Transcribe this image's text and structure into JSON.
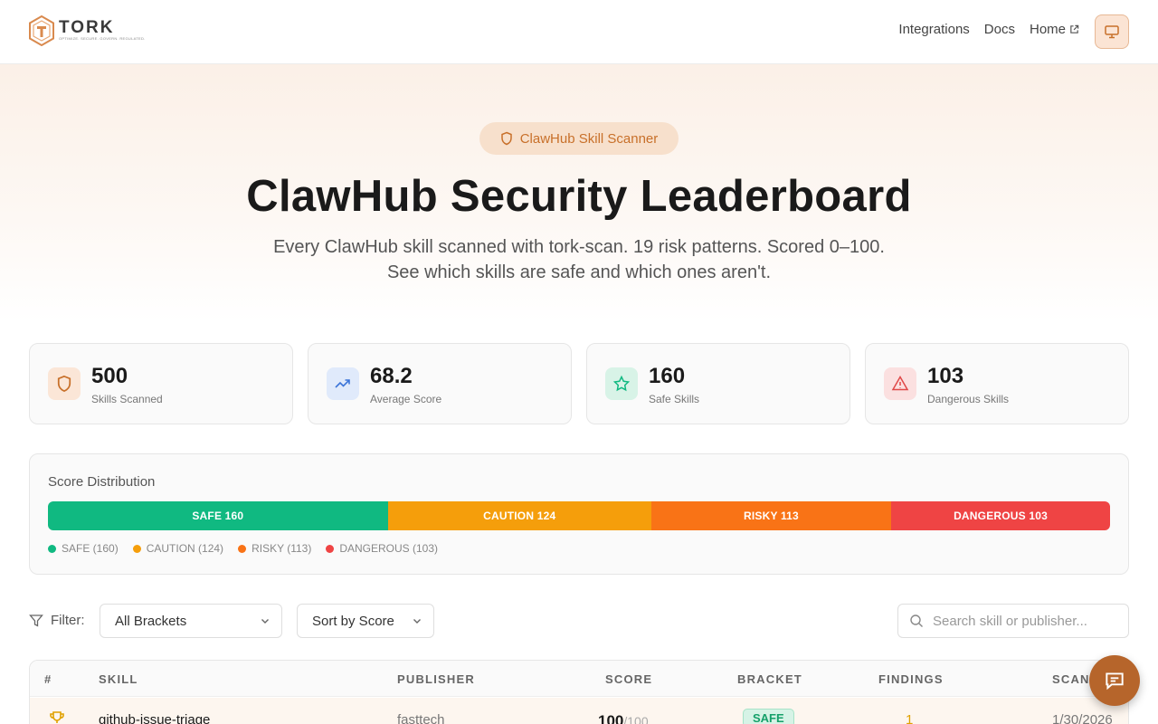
{
  "brand": {
    "name": "TORK",
    "tagline": "OPTIMIZE. SECURE. GOVERN. REGULATED."
  },
  "nav": {
    "items": [
      "Integrations",
      "Docs",
      "Home"
    ]
  },
  "hero": {
    "badge": "ClawHub Skill Scanner",
    "title": "ClawHub Security Leaderboard",
    "subtitle": "Every ClawHub skill scanned with tork-scan. 19 risk patterns. Scored 0–100. See which skills are safe and which ones aren't."
  },
  "stats": [
    {
      "value": "500",
      "label": "Skills Scanned",
      "icon": "shield-icon"
    },
    {
      "value": "68.2",
      "label": "Average Score",
      "icon": "trending-up-icon"
    },
    {
      "value": "160",
      "label": "Safe Skills",
      "icon": "star-icon"
    },
    {
      "value": "103",
      "label": "Dangerous Skills",
      "icon": "warning-icon"
    }
  ],
  "distribution": {
    "title": "Score Distribution",
    "segments": [
      {
        "label": "SAFE 160",
        "legend": "SAFE (160)",
        "count": 160,
        "color": "#10b981"
      },
      {
        "label": "CAUTION 124",
        "legend": "CAUTION (124)",
        "count": 124,
        "color": "#f59e0b"
      },
      {
        "label": "RISKY 113",
        "legend": "RISKY (113)",
        "count": 113,
        "color": "#f97316"
      },
      {
        "label": "DANGEROUS 103",
        "legend": "DANGEROUS (103)",
        "count": 103,
        "color": "#ef4444"
      }
    ]
  },
  "filters": {
    "label": "Filter:",
    "bracket": "All Brackets",
    "sort": "Sort by Score",
    "search_placeholder": "Search skill or publisher..."
  },
  "table": {
    "columns": [
      "#",
      "SKILL",
      "PUBLISHER",
      "SCORE",
      "BRACKET",
      "FINDINGS",
      "SCANNED"
    ],
    "rows": [
      {
        "rank_icon": "trophy-icon",
        "skill": "github-issue-triage",
        "publisher": "fasttech",
        "score": "100",
        "score_max": "/100",
        "bracket": "SAFE",
        "findings": "1",
        "scanned": "1/30/2026"
      }
    ]
  },
  "colors": {
    "accent": "#c8702a",
    "safe": "#10b981",
    "caution": "#f59e0b",
    "risky": "#f97316",
    "dangerous": "#ef4444"
  }
}
